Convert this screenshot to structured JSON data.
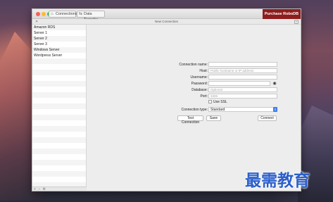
{
  "window": {
    "tabs": [
      {
        "label": "Connections",
        "icon": "home-icon"
      },
      {
        "label": "Data Transfer",
        "icon": "transfer-icon"
      }
    ],
    "purchase_label": "Purchase RoboDB",
    "purchase_color": "#8e1d1d"
  },
  "subheader": {
    "title": "New Connection"
  },
  "sidebar": {
    "items": [
      {
        "label": "Amazon RDS"
      },
      {
        "label": "Server 1"
      },
      {
        "label": "Server 2"
      },
      {
        "label": "Server 3"
      },
      {
        "label": "Windows Server"
      },
      {
        "label": "Wordpress Server"
      }
    ]
  },
  "form": {
    "connection_name": {
      "label": "Connection name:",
      "value": "",
      "placeholder": ""
    },
    "host": {
      "label": "Host:",
      "value": "",
      "placeholder": "Public hostname or IP address"
    },
    "username": {
      "label": "Username:",
      "value": "",
      "placeholder": ""
    },
    "password": {
      "label": "Password:",
      "value": "",
      "placeholder": ""
    },
    "database": {
      "label": "Database:",
      "value": "",
      "placeholder": "Optional"
    },
    "port": {
      "label": "Port:",
      "value": "",
      "placeholder": "3306"
    },
    "use_ssl": {
      "label": "Use SSL",
      "checked": false
    },
    "connection_type": {
      "label": "Connection type:",
      "selected": "Standard"
    }
  },
  "buttons": {
    "test_connection": "Test Connection",
    "save": "Save",
    "connect": "Connect"
  },
  "watermark": {
    "text": "最需教育"
  }
}
